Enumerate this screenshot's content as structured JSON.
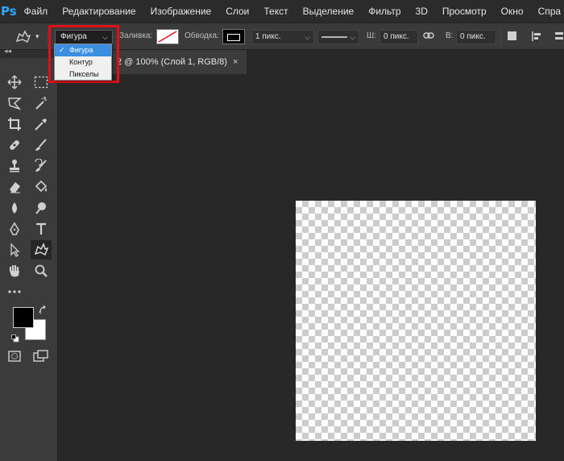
{
  "app": {
    "logo": "Ps"
  },
  "menu": [
    "Файл",
    "Редактирование",
    "Изображение",
    "Слои",
    "Текст",
    "Выделение",
    "Фильтр",
    "3D",
    "Просмотр",
    "Окно",
    "Спра"
  ],
  "options": {
    "mode_value": "Фигура",
    "fill_label": "Заливка:",
    "stroke_label": "Обводка:",
    "stroke_width": "1 пикс.",
    "width_label": "Ш:",
    "width_value": "0 пикс.",
    "height_label": "В:",
    "height_value": "0 пикс."
  },
  "mode_dropdown": {
    "items": [
      {
        "label": "Фигура",
        "selected": true
      },
      {
        "label": "Контур",
        "selected": false
      },
      {
        "label": "Пикселы",
        "selected": false
      }
    ]
  },
  "tab": {
    "title": "2 @ 100% (Слой 1, RGB/8)",
    "close": "×"
  },
  "toolbox": {
    "collapse": "◂◂"
  },
  "colors": {
    "accent": "#31a8ff",
    "highlight": "#e0101a",
    "selection": "#3a8fe0",
    "foreground": "#000000",
    "background": "#ffffff"
  }
}
